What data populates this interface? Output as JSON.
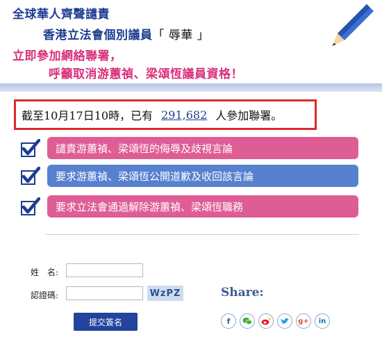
{
  "header": {
    "line1": "全球華人齊聲譴責",
    "line2_prefix": "香港立法會個別議員",
    "line2_quote": "「 辱華 」",
    "line3": "立即參加網絡聯署，",
    "line4": "呼籲取消游蕙禎、梁頌恆議員資格！"
  },
  "counter": {
    "prefix": "截至10月17日10時，已有",
    "count": "291,682",
    "suffix": "人參加聯署。"
  },
  "demands": [
    {
      "label": "譴責游蕙禎、梁頌恆的侮辱及歧視言論",
      "color": "#df5d95"
    },
    {
      "label": "要求游蕙禎、梁頌恆公開道歉及收回該言論",
      "color": "#5780cf"
    },
    {
      "label": "要求立法會通過解除游蕙禎、梁頌恆職務",
      "color": "#df5d95"
    }
  ],
  "form": {
    "name_label": "姓　名:",
    "name_value": "",
    "code_label": "認證碼:",
    "code_value": "",
    "captcha": "WzPZ",
    "submit_label": "提交簽名"
  },
  "share": {
    "label": "Share:",
    "icons": [
      "facebook-icon",
      "wechat-icon",
      "weibo-icon",
      "twitter-icon",
      "google-plus-icon",
      "linkedin-icon"
    ]
  }
}
